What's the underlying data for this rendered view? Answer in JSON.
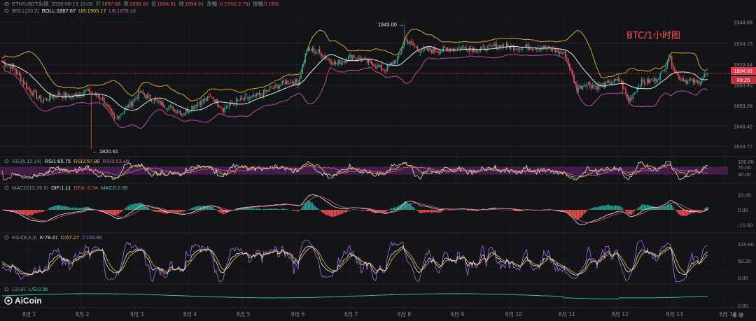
{
  "header_main": {
    "symbol": "ETH/USDT永续",
    "datetime": "2026-08-13 15:00",
    "open_label": "开",
    "open": "1897.68",
    "high_label": "高",
    "high": "1898.00",
    "low_label": "低",
    "low": "1894.91",
    "close_label": "收",
    "close": "1894.91",
    "change_label": "涨幅",
    "change": "-0.15%(-2.76)",
    "amp_label": "振幅",
    "amp": "0.16%"
  },
  "header_boll": {
    "name": "BOLL(20,2)",
    "boll": "BOLL:1887.67",
    "ub": "UB:1905.17",
    "lb": "LB:1870.18"
  },
  "header_rsi": {
    "name": "RSI(6,12,24)",
    "rsi1": "RSI1:65.75",
    "rsi2": "RSI2:57.88",
    "rsi3": "RSI3:53.48"
  },
  "header_macd": {
    "name": "MACD(12,26,9)",
    "dif": "DIF:1.11",
    "dea": "DEA:-0.34",
    "macd": "MACD:2.90"
  },
  "header_kdj": {
    "name": "KDJ(9,3,3)",
    "k": "K:79.47",
    "d": "D:67.27",
    "j": "J:103.88"
  },
  "header_lsur": {
    "name": "LSUR",
    "ls": "L/S:2.36"
  },
  "annotation": "BTC/1小时图",
  "price_box": {
    "price": "1894.91",
    "countdown": "09:25"
  },
  "logo_text": "AiCoin",
  "corner_button": "筹 爆",
  "colors": {
    "up": "#26a69a",
    "down": "#ef5350",
    "boll": "#e6e6e6",
    "ub": "#d9a821",
    "lb": "#c24aa8",
    "rsi_band": "#4b1f52"
  },
  "chart_data": [
    {
      "type": "candlestick",
      "title": "ETH/USDT永续",
      "x_ticks": [
        "8月 1",
        "8月 2",
        "8月 3",
        "8月 4",
        "8月 5",
        "8月 6",
        "8月 7",
        "8月 8",
        "8月 9",
        "8月 10",
        "8月 11",
        "8月 12",
        "8月 13",
        "8月 14"
      ],
      "y_ticks": [
        1823.77,
        1843.42,
        1863.28,
        1883.45,
        1903.64,
        1924.15,
        1944.88
      ],
      "ylim": [
        1815,
        1950
      ],
      "current_price": 1894.91,
      "annotations": [
        {
          "label": "1943.00",
          "value": 1943.0
        },
        {
          "label": "1820.61",
          "value": 1820.61
        }
      ],
      "close_keypoints": [
        [
          0,
          1906
        ],
        [
          8,
          1900
        ],
        [
          18,
          1880
        ],
        [
          28,
          1868
        ],
        [
          38,
          1875
        ],
        [
          48,
          1872
        ],
        [
          58,
          1878
        ],
        [
          70,
          1870
        ],
        [
          78,
          1850
        ],
        [
          86,
          1860
        ],
        [
          96,
          1876
        ],
        [
          106,
          1868
        ],
        [
          116,
          1862
        ],
        [
          126,
          1856
        ],
        [
          136,
          1866
        ],
        [
          146,
          1872
        ],
        [
          154,
          1860
        ],
        [
          164,
          1868
        ],
        [
          176,
          1872
        ],
        [
          188,
          1880
        ],
        [
          198,
          1887
        ],
        [
          206,
          1886
        ],
        [
          212,
          1918
        ],
        [
          220,
          1916
        ],
        [
          232,
          1904
        ],
        [
          244,
          1912
        ],
        [
          256,
          1905
        ],
        [
          266,
          1898
        ],
        [
          276,
          1910
        ],
        [
          280,
          1928
        ],
        [
          290,
          1918
        ],
        [
          304,
          1917
        ],
        [
          318,
          1920
        ],
        [
          332,
          1918
        ],
        [
          346,
          1922
        ],
        [
          360,
          1920
        ],
        [
          372,
          1921
        ],
        [
          384,
          1918
        ],
        [
          392,
          1913
        ],
        [
          400,
          1880
        ],
        [
          406,
          1885
        ],
        [
          414,
          1882
        ],
        [
          422,
          1885
        ],
        [
          430,
          1888
        ],
        [
          436,
          1868
        ],
        [
          444,
          1886
        ],
        [
          454,
          1888
        ],
        [
          460,
          1896
        ],
        [
          464,
          1912
        ],
        [
          470,
          1892
        ],
        [
          476,
          1888
        ],
        [
          484,
          1886
        ],
        [
          491,
          1896
        ]
      ]
    },
    {
      "type": "line",
      "title": "RSI(6,12,24)",
      "y_ticks": [
        100.0,
        70.0,
        30.0
      ],
      "ylim": [
        0,
        100
      ],
      "series": [
        {
          "name": "RSI1",
          "last": 65.75
        },
        {
          "name": "RSI2",
          "last": 57.88
        },
        {
          "name": "RSI3",
          "last": 53.48
        }
      ]
    },
    {
      "type": "bar",
      "title": "MACD(12,26,9)",
      "y_ticks": [
        10.0,
        0.0,
        -10.0
      ],
      "ylim": [
        -14,
        14
      ],
      "series": [
        {
          "name": "DIF",
          "last": 1.11
        },
        {
          "name": "DEA",
          "last": -0.34
        },
        {
          "name": "MACD",
          "last": 2.9
        }
      ]
    },
    {
      "type": "line",
      "title": "KDJ(9,3,3)",
      "y_ticks": [
        100.0,
        50.0,
        0.0
      ],
      "ylim": [
        -15,
        115
      ],
      "series": [
        {
          "name": "K",
          "last": 79.47
        },
        {
          "name": "D",
          "last": 67.27
        },
        {
          "name": "J",
          "last": 103.88
        }
      ]
    },
    {
      "type": "line",
      "title": "LSUR",
      "y_ticks": [
        2.0
      ],
      "series": [
        {
          "name": "L/S",
          "last": 2.36
        }
      ]
    }
  ]
}
